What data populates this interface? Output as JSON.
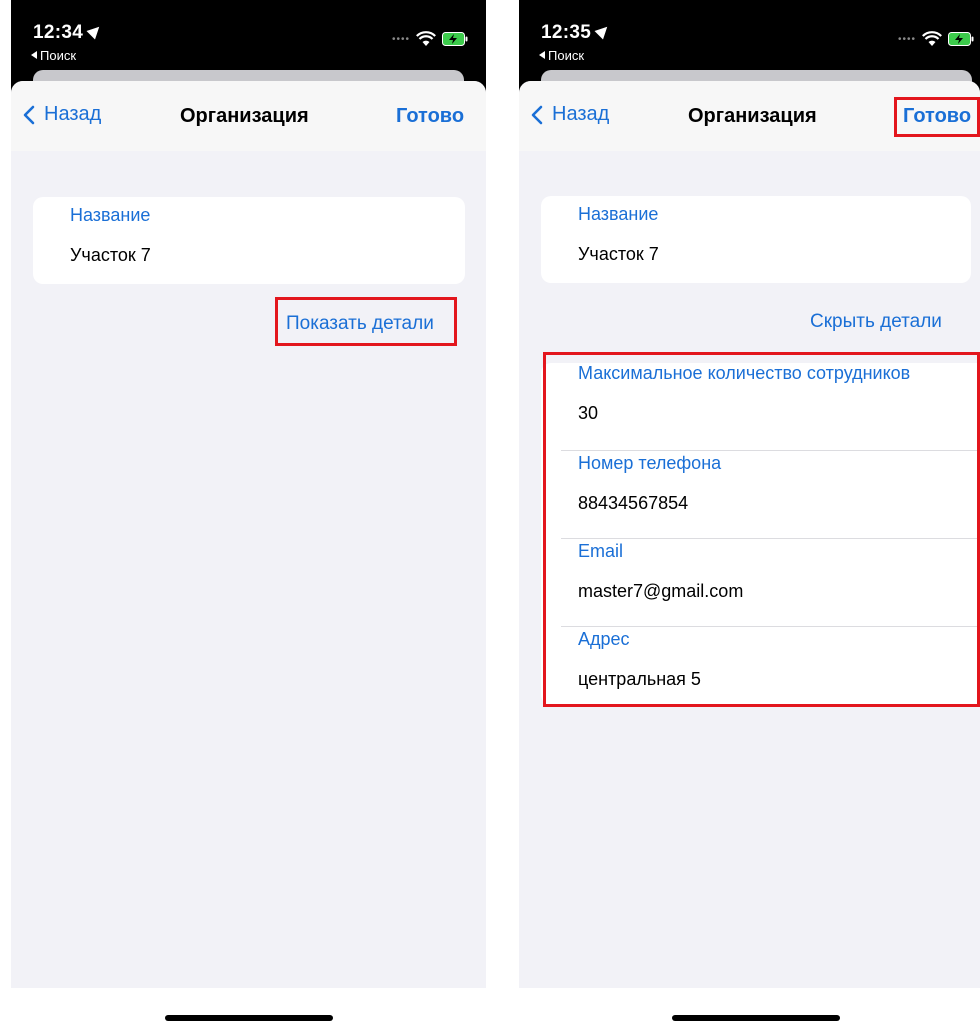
{
  "screens": [
    {
      "status_time": "12:34",
      "back_app": "Поиск",
      "nav_back": "Назад",
      "nav_title": "Организация",
      "nav_done": "Готово",
      "name_label": "Название",
      "name_value": "Участок 7",
      "details_link": "Показать детали"
    },
    {
      "status_time": "12:35",
      "back_app": "Поиск",
      "nav_back": "Назад",
      "nav_title": "Организация",
      "nav_done": "Готово",
      "name_label": "Название",
      "name_value": "Участок 7",
      "details_link": "Скрыть детали",
      "details": [
        {
          "label": "Максимальное количество сотрудников",
          "value": "30"
        },
        {
          "label": "Номер телефона",
          "value": "88434567854"
        },
        {
          "label": "Email",
          "value": "master7@gmail.com"
        },
        {
          "label": "Адрес",
          "value": "центральная 5"
        }
      ]
    }
  ],
  "colors": {
    "accent": "#1a6fd6",
    "highlight": "#e3161d",
    "background": "#f2f2f7"
  }
}
